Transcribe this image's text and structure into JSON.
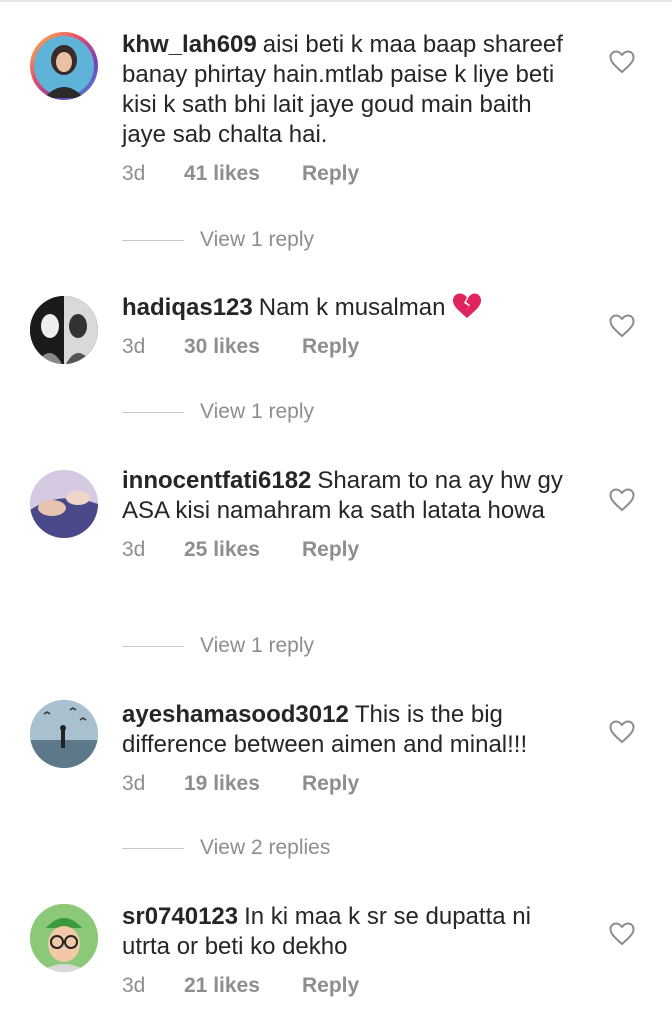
{
  "comments": [
    {
      "username": "khw_lah609",
      "text": "aisi beti k maa baap shareef banay phirtay hain.mtlab paise k liye beti kisi k sath bhi lait jaye goud main baith jaye sab chalta hai.",
      "time": "3d",
      "likes": "41 likes",
      "reply": "Reply",
      "view_replies": "View 1 reply",
      "avatar_icon": "profile-photo"
    },
    {
      "username": "hadiqas123",
      "text": "Nam k musalman",
      "emoji": "broken-heart",
      "time": "3d",
      "likes": "30 likes",
      "reply": "Reply",
      "view_replies": "View 1 reply",
      "avatar_icon": "profile-photo"
    },
    {
      "username": "innocentfati6182",
      "text": "Sharam to na ay hw gy ASA kisi namahram ka sath latata howa",
      "time": "3d",
      "likes": "25 likes",
      "reply": "Reply",
      "view_replies": "View 1 reply",
      "avatar_icon": "profile-photo"
    },
    {
      "username": "ayeshamasood3012",
      "text": "This is the big difference between aimen and minal!!!",
      "time": "3d",
      "likes": "19 likes",
      "reply": "Reply",
      "view_replies": "View 2 replies",
      "avatar_icon": "profile-photo"
    },
    {
      "username": "sr0740123",
      "text": "In ki maa k sr se dupatta ni utrta or beti ko dekho",
      "time": "3d",
      "likes": "21 likes",
      "reply": "Reply",
      "avatar_icon": "profile-photo"
    }
  ],
  "colors": {
    "text": "#262626",
    "meta": "#8e8e8e",
    "rule": "#c7c7c7",
    "heart_stroke": "#8e8e8e",
    "emoji": "#e0245e"
  },
  "icons": {
    "like": "heart-outline-icon",
    "emoji": "broken-heart-icon"
  }
}
